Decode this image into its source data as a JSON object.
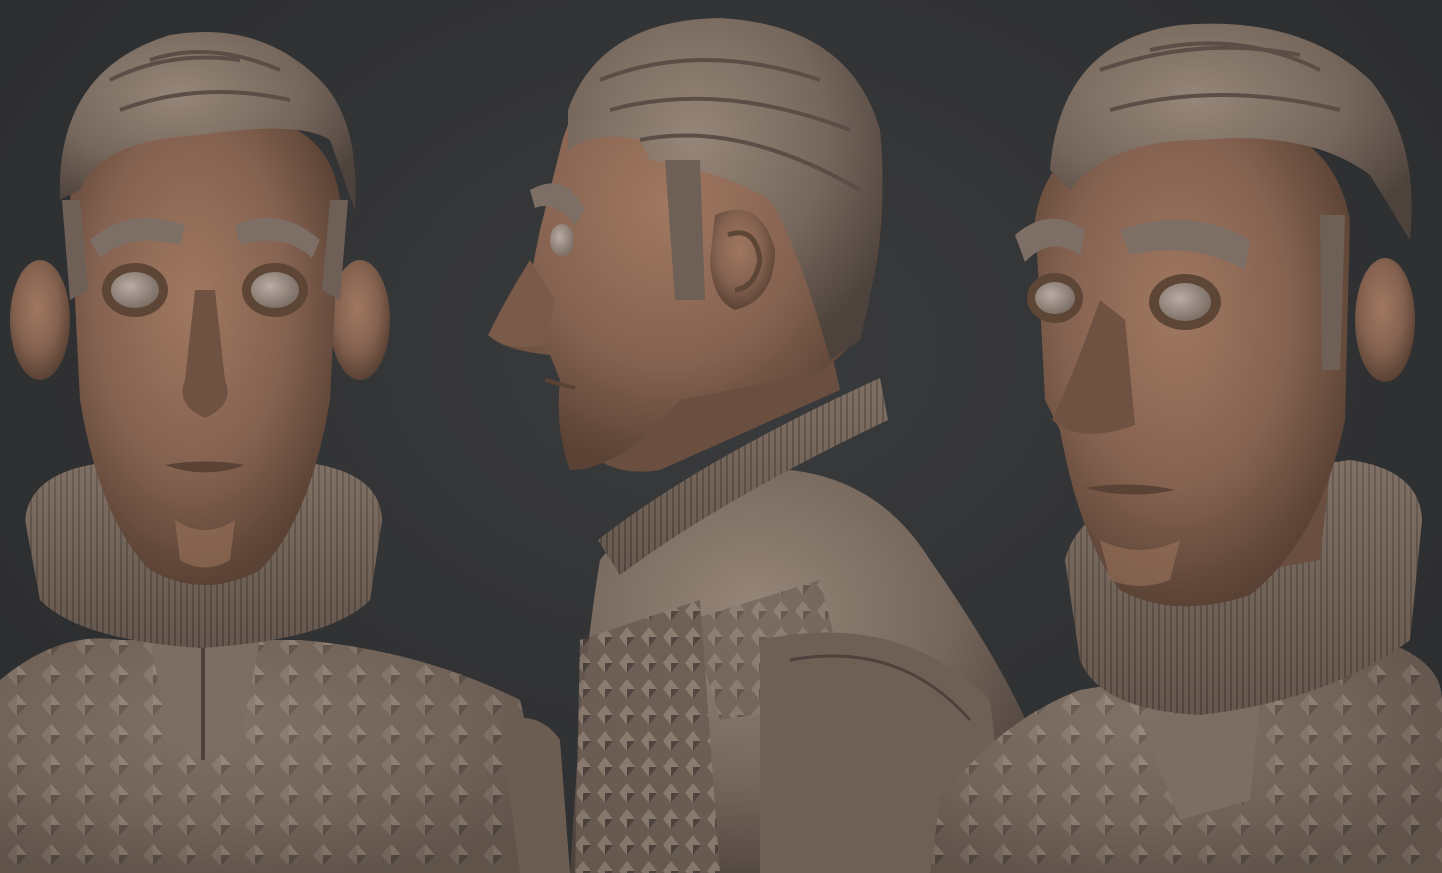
{
  "scene": {
    "views": [
      {
        "name": "front",
        "label": "front-view"
      },
      {
        "name": "profile",
        "label": "profile-view"
      },
      {
        "name": "three-quarter",
        "label": "three-quarter-view"
      }
    ]
  },
  "colors": {
    "background": "#2e2f31",
    "skin": "#8a6650",
    "skin_shadow": "#5e4636",
    "clay": "#7a6b60",
    "clay_dark": "#4f443d",
    "clay_light": "#9c8c80",
    "eye": "#9a8d84"
  }
}
